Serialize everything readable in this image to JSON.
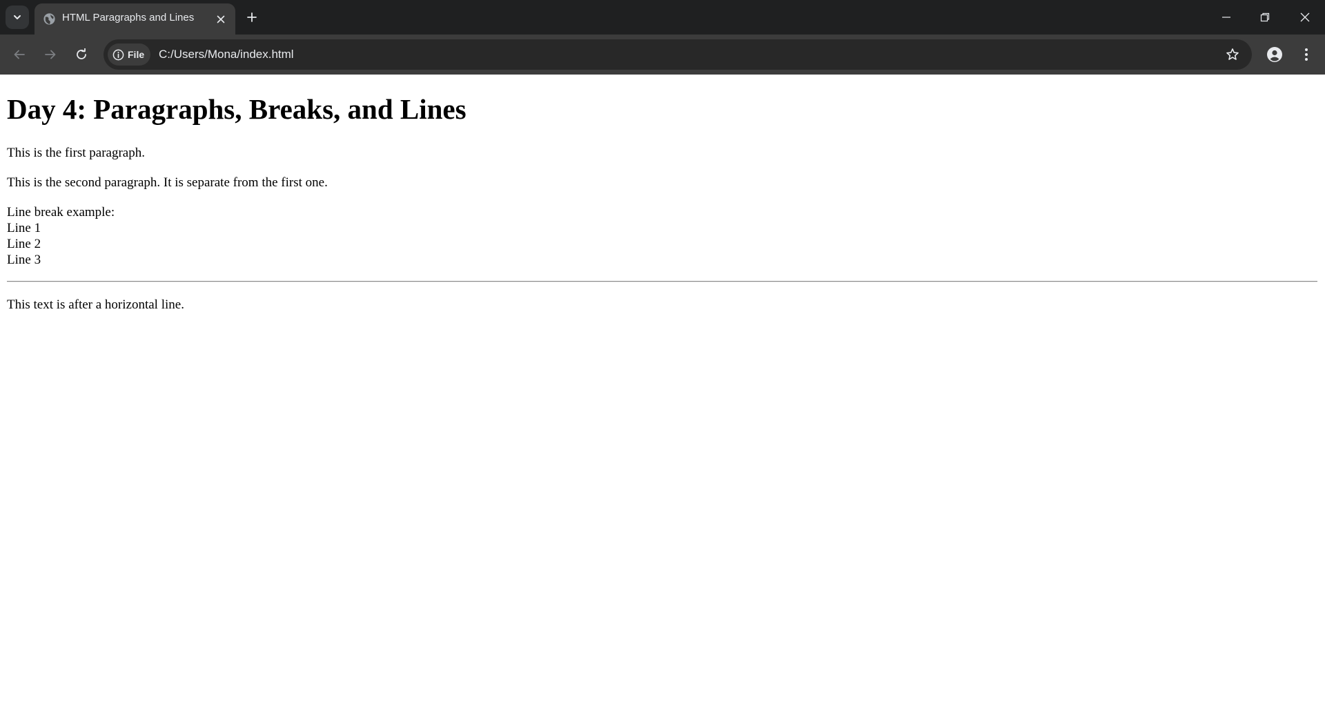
{
  "browser": {
    "tab": {
      "title": "HTML Paragraphs and Lines",
      "favicon": "globe-icon"
    },
    "address_bar": {
      "chip_label": "File",
      "url": "C:/Users/Mona/index.html"
    },
    "colors": {
      "tabstrip": "#1f2021",
      "toolbar": "#3c3c3c",
      "omnibox": "#282828",
      "text": "#e8eaed"
    }
  },
  "page": {
    "heading": "Day 4: Paragraphs, Breaks, and Lines",
    "paragraph_1": "This is the first paragraph.",
    "paragraph_2": "This is the second paragraph. It is separate from the first one.",
    "line_break_intro": "Line break example:",
    "lines": [
      "Line 1",
      "Line 2",
      "Line 3"
    ],
    "after_hr": "This text is after a horizontal line."
  }
}
